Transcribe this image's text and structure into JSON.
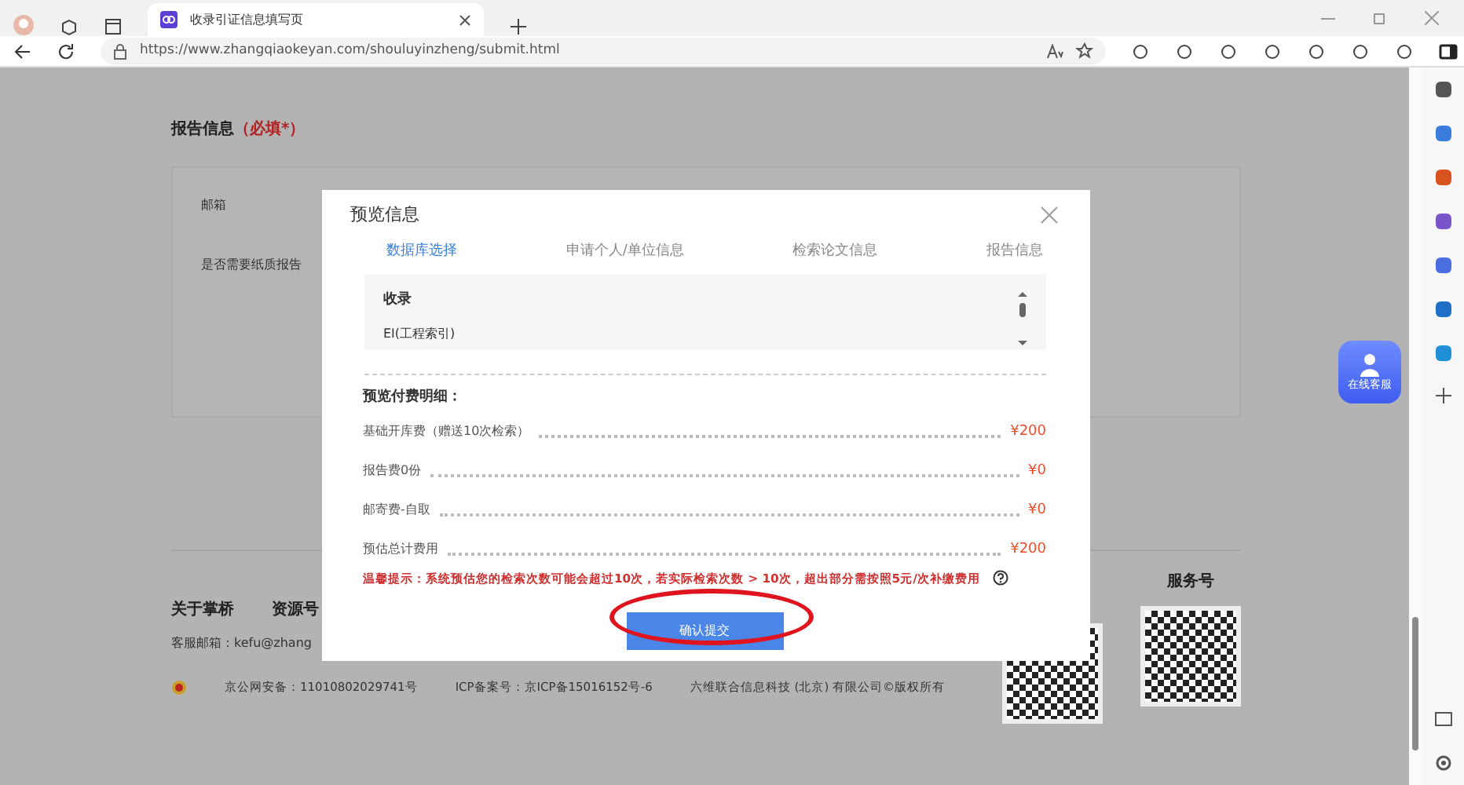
{
  "browser": {
    "tab_title": "收录引证信息填写页",
    "url": "https://www.zhangqiaokeyan.com/shouluyinzheng/submit.html"
  },
  "page": {
    "section_title": "报告信息",
    "required_note": "（必填*）",
    "form_labels": [
      "邮箱",
      "是否需要纸质报告"
    ],
    "footer": {
      "links": [
        "关于掌桥",
        "资源号"
      ],
      "contact": "客服邮箱：kefu@zhang",
      "legal": [
        "京公网安备：11010802029741号",
        "ICP备案号：京ICP备15016152号-6",
        "六维联合信息科技 (北京) 有限公司©版权所有"
      ],
      "qr_title": "服务号"
    },
    "chat_widget": "在线客服"
  },
  "modal": {
    "title": "预览信息",
    "tabs": [
      {
        "label": "数据库选择",
        "selected": true
      },
      {
        "label": "申请个人/单位信息",
        "selected": false
      },
      {
        "label": "检索论文信息",
        "selected": false
      },
      {
        "label": "报告信息",
        "selected": false
      }
    ],
    "box": {
      "heading": "收录",
      "value": "EI(工程索引)"
    },
    "fees_title": "预览付费明细：",
    "fees": [
      {
        "label": "基础开库费（赠送10次检索）",
        "amount": "¥200"
      },
      {
        "label": "报告费0份",
        "amount": "¥0"
      },
      {
        "label": "邮寄费-自取",
        "amount": "¥0"
      },
      {
        "label": "预估总计费用",
        "amount": "¥200"
      }
    ],
    "warning": "温馨提示：系统预估您的检索次数可能会超过10次，若实际检索次数 > 10次，超出部分需按照5元/次补缴费用",
    "submit": "确认提交"
  }
}
